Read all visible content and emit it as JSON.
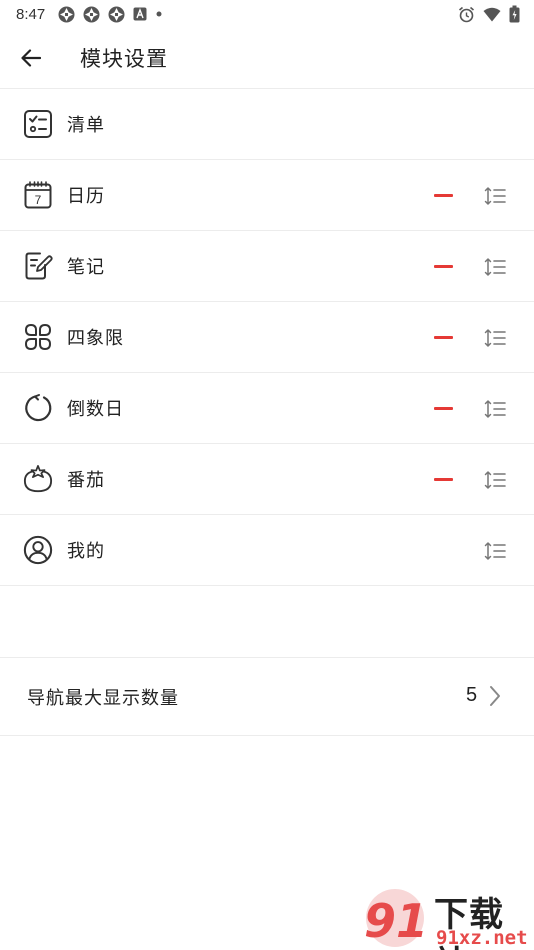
{
  "status_bar": {
    "time": "8:47",
    "left_icons": [
      "app-notification-icon",
      "app-notification-icon",
      "app-notification-icon",
      "app-a-icon",
      "dot-icon"
    ],
    "right_icons": [
      "alarm-icon",
      "wifi-icon",
      "battery-charging-icon"
    ]
  },
  "app_bar": {
    "back_icon": "arrow-left-icon",
    "title": "模块设置"
  },
  "modules": [
    {
      "label": "清单",
      "icon": "checklist-icon",
      "removable": false
    },
    {
      "label": "日历",
      "icon": "calendar-icon",
      "removable": true
    },
    {
      "label": "笔记",
      "icon": "note-edit-icon",
      "removable": true
    },
    {
      "label": "四象限",
      "icon": "quadrant-icon",
      "removable": true
    },
    {
      "label": "倒数日",
      "icon": "countdown-icon",
      "removable": true
    },
    {
      "label": "番茄",
      "icon": "tomato-icon",
      "removable": true
    },
    {
      "label": "我的",
      "icon": "user-circle-icon",
      "removable": false
    }
  ],
  "nav_max": {
    "label": "导航最大显示数量",
    "value": "5"
  },
  "watermark": {
    "badge_text": "91",
    "title": "下载站",
    "subtitle": "91xz.net"
  },
  "colors": {
    "remove": "#e53935",
    "divider": "#ececec",
    "text": "#222222",
    "icon_gray": "#888888"
  }
}
